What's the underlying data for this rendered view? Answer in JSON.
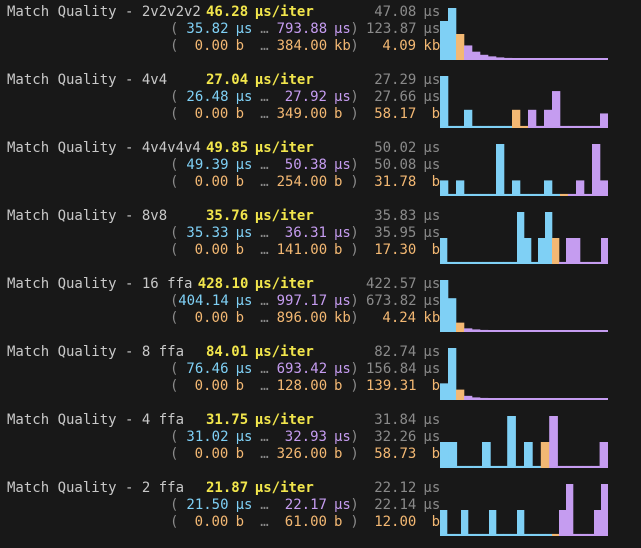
{
  "colors": {
    "background": "#181818",
    "name": "#c8c8c8",
    "avg": "#f2e64c",
    "min": "#7fd0f5",
    "max": "#c59cf0",
    "alloc": "#f3b873",
    "muted": "#8a8a8a",
    "hist_low": "#7fd0f5",
    "hist_mid": "#f3b873",
    "hist_high": "#c59cf0"
  },
  "unit_labels": {
    "us": "µs",
    "per_iter": "µs/iter",
    "b": "b",
    "kb": "kb"
  },
  "benches": [
    {
      "name": "Match Quality - 2v2v2v2",
      "avg": "46.28",
      "avg_unit": "µs/iter",
      "p75": "47.08",
      "p75_unit": "µs",
      "min": "35.82",
      "min_unit": "µs",
      "max": "793.88",
      "max_unit": "µs",
      "p99": "123.87",
      "p99_unit": "µs",
      "heap_min": "0.00",
      "heap_min_unit": "b",
      "heap_max": "384.00",
      "heap_max_unit": "kb",
      "heap_avg": "4.09",
      "heap_avg_unit": "kb",
      "histogram": [
        0.75,
        1.0,
        0.5,
        0.28,
        0.16,
        0.1,
        0.07,
        0.05,
        0.04,
        0.03,
        0.03,
        0.02,
        0.02,
        0.02,
        0.02,
        0.02,
        0.02,
        0.02,
        0.02,
        0.02,
        0.02
      ],
      "hist_colors": [
        "low",
        "low",
        "mid",
        "high",
        "high",
        "high",
        "high",
        "high",
        "high",
        "high",
        "high",
        "high",
        "high",
        "high",
        "high",
        "high",
        "high",
        "high",
        "high",
        "high",
        "high"
      ]
    },
    {
      "name": "Match Quality - 4v4",
      "avg": "27.04",
      "avg_unit": "µs/iter",
      "p75": "27.29",
      "p75_unit": "µs",
      "min": "26.48",
      "min_unit": "µs",
      "max": "27.92",
      "max_unit": "µs",
      "p99": "27.66",
      "p99_unit": "µs",
      "heap_min": "0.00",
      "heap_min_unit": "b",
      "heap_max": "349.00",
      "heap_max_unit": "b",
      "heap_avg": "58.17",
      "heap_avg_unit": "b",
      "histogram": [
        1.0,
        0.04,
        0.04,
        0.35,
        0.04,
        0.04,
        0.04,
        0.04,
        0.04,
        0.35,
        0.04,
        0.35,
        0.04,
        0.35,
        0.71,
        0.04,
        0.04,
        0.04,
        0.04,
        0.04,
        0.28
      ],
      "hist_colors": [
        "low",
        "low",
        "low",
        "low",
        "low",
        "low",
        "low",
        "low",
        "low",
        "mid",
        "mid",
        "high",
        "high",
        "high",
        "high",
        "high",
        "high",
        "high",
        "high",
        "high",
        "high"
      ]
    },
    {
      "name": "Match Quality - 4v4v4v4",
      "avg": "49.85",
      "avg_unit": "µs/iter",
      "p75": "50.02",
      "p75_unit": "µs",
      "min": "49.39",
      "min_unit": "µs",
      "max": "50.38",
      "max_unit": "µs",
      "p99": "50.08",
      "p99_unit": "µs",
      "heap_min": "0.00",
      "heap_min_unit": "b",
      "heap_max": "254.00",
      "heap_max_unit": "b",
      "heap_avg": "31.78",
      "heap_avg_unit": "b",
      "histogram": [
        0.3,
        0.04,
        0.3,
        0.04,
        0.04,
        0.04,
        0.04,
        1.0,
        0.04,
        0.3,
        0.04,
        0.04,
        0.04,
        0.3,
        0.04,
        0.04,
        0.04,
        0.3,
        0.04,
        1.0,
        0.3
      ],
      "hist_colors": [
        "low",
        "low",
        "low",
        "low",
        "low",
        "low",
        "low",
        "low",
        "low",
        "low",
        "low",
        "low",
        "low",
        "low",
        "low",
        "mid",
        "high",
        "high",
        "high",
        "high",
        "high"
      ]
    },
    {
      "name": "Match Quality - 8v8",
      "avg": "35.76",
      "avg_unit": "µs/iter",
      "p75": "35.83",
      "p75_unit": "µs",
      "min": "35.33",
      "min_unit": "µs",
      "max": "36.31",
      "max_unit": "µs",
      "p99": "35.95",
      "p99_unit": "µs",
      "heap_min": "0.00",
      "heap_min_unit": "b",
      "heap_max": "141.00",
      "heap_max_unit": "b",
      "heap_avg": "17.30",
      "heap_avg_unit": "b",
      "histogram": [
        0.5,
        0.04,
        0.04,
        0.04,
        0.04,
        0.04,
        0.04,
        0.04,
        0.04,
        0.04,
        0.04,
        1.0,
        0.5,
        0.04,
        0.5,
        1.0,
        0.5,
        0.04,
        0.5,
        0.5,
        0.04,
        0.04,
        0.04,
        0.5
      ],
      "hist_colors": [
        "low",
        "low",
        "low",
        "low",
        "low",
        "low",
        "low",
        "low",
        "low",
        "low",
        "low",
        "low",
        "low",
        "low",
        "low",
        "low",
        "mid",
        "high",
        "high",
        "high",
        "high",
        "high",
        "high",
        "high"
      ]
    },
    {
      "name": "Match Quality - 16 ffa",
      "avg": "428.10",
      "avg_unit": "µs/iter",
      "p75": "422.57",
      "p75_unit": "µs",
      "min": "404.14",
      "min_unit": "µs",
      "max": "997.17",
      "max_unit": "µs",
      "p99": "673.82",
      "p99_unit": "µs",
      "heap_min": "0.00",
      "heap_min_unit": "b",
      "heap_max": "896.00",
      "heap_max_unit": "kb",
      "heap_avg": "4.24",
      "heap_avg_unit": "kb",
      "histogram": [
        1.0,
        0.65,
        0.18,
        0.07,
        0.05,
        0.04,
        0.03,
        0.02,
        0.02,
        0.02,
        0.02,
        0.02,
        0.02,
        0.02,
        0.02,
        0.02,
        0.02,
        0.02,
        0.02,
        0.02,
        0.02
      ],
      "hist_colors": [
        "low",
        "low",
        "mid",
        "high",
        "high",
        "high",
        "high",
        "high",
        "high",
        "high",
        "high",
        "high",
        "high",
        "high",
        "high",
        "high",
        "high",
        "high",
        "high",
        "high",
        "high"
      ]
    },
    {
      "name": "Match Quality - 8 ffa",
      "avg": "84.01",
      "avg_unit": "µs/iter",
      "p75": "82.74",
      "p75_unit": "µs",
      "min": "76.46",
      "min_unit": "µs",
      "max": "693.42",
      "max_unit": "µs",
      "p99": "156.84",
      "p99_unit": "µs",
      "heap_min": "0.00",
      "heap_min_unit": "b",
      "heap_max": "128.00",
      "heap_max_unit": "b",
      "heap_avg": "139.31",
      "heap_avg_unit": "b",
      "histogram": [
        0.32,
        1.0,
        0.2,
        0.08,
        0.05,
        0.04,
        0.03,
        0.02,
        0.02,
        0.02,
        0.02,
        0.02,
        0.02,
        0.02,
        0.02,
        0.02,
        0.02,
        0.02,
        0.02,
        0.02,
        0.02
      ],
      "hist_colors": [
        "low",
        "low",
        "mid",
        "high",
        "high",
        "high",
        "high",
        "high",
        "high",
        "high",
        "high",
        "high",
        "high",
        "high",
        "high",
        "high",
        "high",
        "high",
        "high",
        "high",
        "high"
      ]
    },
    {
      "name": "Match Quality - 4 ffa",
      "avg": "31.75",
      "avg_unit": "µs/iter",
      "p75": "31.84",
      "p75_unit": "µs",
      "min": "31.02",
      "min_unit": "µs",
      "max": "32.93",
      "max_unit": "µs",
      "p99": "32.26",
      "p99_unit": "µs",
      "heap_min": "0.00",
      "heap_min_unit": "b",
      "heap_max": "326.00",
      "heap_max_unit": "b",
      "heap_avg": "58.73",
      "heap_avg_unit": "b",
      "histogram": [
        0.5,
        0.5,
        0.04,
        0.04,
        0.04,
        0.5,
        0.04,
        0.04,
        1.0,
        0.04,
        0.5,
        0.04,
        0.5,
        1.0,
        0.04,
        0.04,
        0.04,
        0.04,
        0.04,
        0.5
      ],
      "hist_colors": [
        "low",
        "low",
        "low",
        "low",
        "low",
        "low",
        "low",
        "low",
        "low",
        "low",
        "low",
        "low",
        "mid",
        "high",
        "high",
        "high",
        "high",
        "high",
        "high",
        "high"
      ]
    },
    {
      "name": "Match Quality - 2 ffa",
      "avg": "21.87",
      "avg_unit": "µs/iter",
      "p75": "22.12",
      "p75_unit": "µs",
      "min": "21.50",
      "min_unit": "µs",
      "max": "22.17",
      "max_unit": "µs",
      "p99": "22.14",
      "p99_unit": "µs",
      "heap_min": "0.00",
      "heap_min_unit": "b",
      "heap_max": "61.00",
      "heap_max_unit": "b",
      "heap_avg": "12.00",
      "heap_avg_unit": "b",
      "histogram": [
        0.5,
        0.04,
        0.04,
        0.5,
        0.04,
        0.04,
        0.04,
        0.5,
        0.04,
        0.04,
        0.04,
        0.5,
        0.04,
        0.04,
        0.04,
        0.04,
        0.04,
        0.5,
        1.0,
        0.04,
        0.04,
        0.04,
        0.5,
        1.0
      ],
      "hist_colors": [
        "low",
        "low",
        "low",
        "low",
        "low",
        "low",
        "low",
        "low",
        "low",
        "low",
        "low",
        "low",
        "low",
        "low",
        "low",
        "low",
        "mid",
        "high",
        "high",
        "high",
        "high",
        "high",
        "high",
        "high"
      ]
    }
  ]
}
